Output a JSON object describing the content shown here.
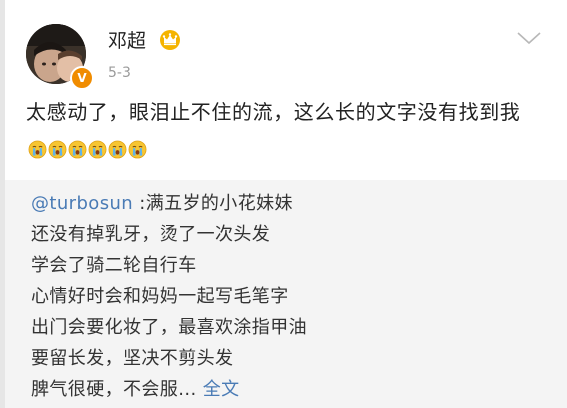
{
  "post": {
    "author": "邓超",
    "date": "5-3",
    "text": "太感动了，眼泪止不住的流，这么长的文字没有找到我",
    "emoji_name": "cry-emoji",
    "emoji_count": 6
  },
  "repost": {
    "mention": "@turbosun",
    "first_line": " :满五岁的小花妹妹",
    "lines": [
      "还没有掉乳牙，烫了一次头发",
      "学会了骑二轮自行车",
      "心情好时会和妈妈一起写毛笔字",
      "出门会要化妆了，最喜欢涂指甲油",
      "要留长发，坚决不剪头发"
    ],
    "last_line": "脾气很硬，不会服...",
    "more_label": "全文"
  },
  "colors": {
    "link": "#4a7bb5",
    "verified_badge": "#f08c00",
    "crown": "#f5b400",
    "repost_background": "#f4f4f4"
  },
  "icons": {
    "verified": "verified-v-icon",
    "crown": "crown-icon",
    "menu": "chevron-down-icon"
  }
}
